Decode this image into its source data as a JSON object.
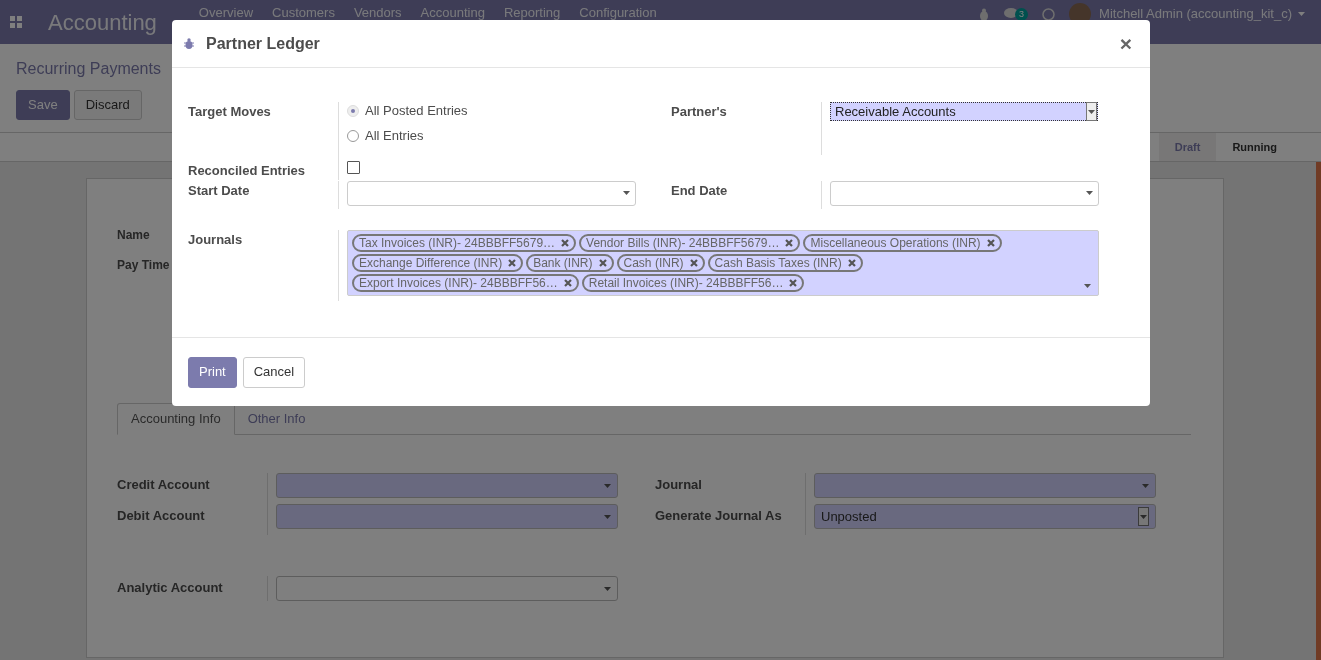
{
  "navbar": {
    "app_title": "Accounting",
    "menu": [
      "Overview",
      "Customers",
      "Vendors",
      "Accounting",
      "Reporting",
      "Configuration"
    ],
    "chat_count": "3",
    "user": "Mitchell Admin (accounting_kit_c)"
  },
  "breadcrumb": "Recurring Payments",
  "buttons": [
    {
      "label": "Save",
      "kind": "primary"
    },
    {
      "label": "Discard",
      "kind": "secondary"
    }
  ],
  "status_bar": [
    {
      "label": "Draft",
      "selected": false
    },
    {
      "label": "Running",
      "selected": true
    }
  ],
  "form": {
    "top_fields": [
      {
        "label": "Name"
      },
      {
        "label": "Pay Time"
      }
    ],
    "tabs": [
      {
        "label": "Accounting Info",
        "selected": true
      },
      {
        "label": "Other Info",
        "selected": false
      }
    ],
    "left_fields": [
      {
        "label": "Credit Account",
        "required": true
      },
      {
        "label": "Debit Account",
        "required": true
      }
    ],
    "right_fields": [
      {
        "label": "Journal",
        "required": true,
        "kind": "many2one"
      },
      {
        "label": "Generate Journal As",
        "required": true,
        "kind": "select",
        "value": "Unposted"
      }
    ],
    "analytic": {
      "label": "Analytic Account",
      "required": false
    }
  },
  "dialog": {
    "title": "Partner Ledger",
    "close": "×",
    "target_moves": {
      "label": "Target Moves",
      "options": [
        {
          "label": "All Posted Entries",
          "selected": true
        },
        {
          "label": "All Entries",
          "selected": false
        }
      ]
    },
    "partners": {
      "label": "Partner's",
      "value": "Receivable Accounts"
    },
    "reconciled": {
      "label": "Reconciled Entries",
      "checked": false
    },
    "start_date": {
      "label": "Start Date"
    },
    "end_date": {
      "label": "End Date"
    },
    "journals": {
      "label": "Journals",
      "tags": [
        "Tax Invoices (INR)- 24BBBFF5679…",
        "Vendor Bills (INR)- 24BBBFF5679…",
        "Miscellaneous Operations (INR)",
        "Exchange Difference (INR)",
        "Bank (INR)",
        "Cash (INR)",
        "Cash Basis Taxes (INR)",
        "Export Invoices (INR)- 24BBBFF56…",
        "Retail Invoices (INR)- 24BBBFF56…"
      ]
    },
    "buttons": [
      {
        "label": "Print",
        "kind": "primary"
      },
      {
        "label": "Cancel",
        "kind": "secondary"
      }
    ]
  }
}
